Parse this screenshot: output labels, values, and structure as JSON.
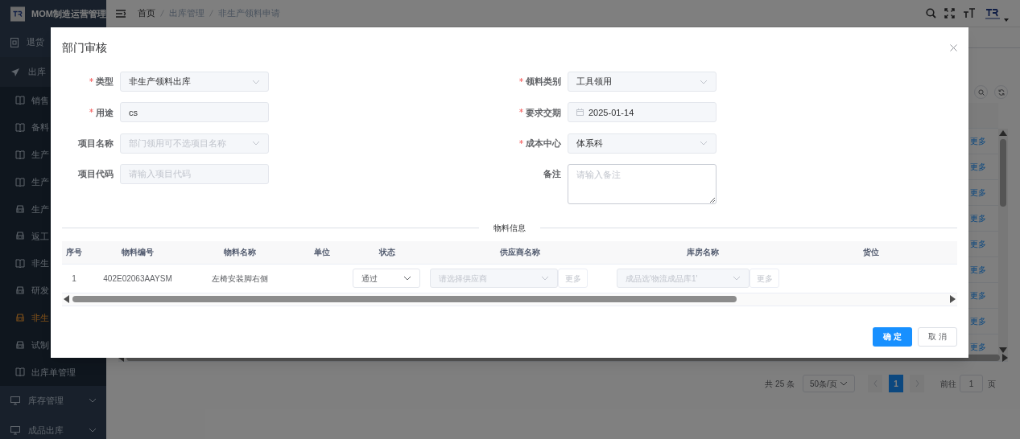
{
  "sidebar": {
    "title": "MOM制造运营管理",
    "items": [
      {
        "label": "退货"
      },
      {
        "label": "出库",
        "expanded": true,
        "children": [
          {
            "label": "销售",
            "selected": false
          },
          {
            "label": "备料",
            "selected": false
          },
          {
            "label": "生产",
            "selected": false
          },
          {
            "label": "生产",
            "selected": false
          },
          {
            "label": "生产",
            "selected": false
          },
          {
            "label": "返工",
            "selected": false
          },
          {
            "label": "非生",
            "selected": false
          },
          {
            "label": "研发",
            "selected": false
          },
          {
            "label": "非生",
            "selected": true
          },
          {
            "label": "试制",
            "selected": false
          },
          {
            "label": "出库单管理",
            "selected": false
          }
        ]
      },
      {
        "label": "库存管理",
        "expanded": false
      },
      {
        "label": "成品出库",
        "expanded": false
      }
    ]
  },
  "header": {
    "breadcrumb": [
      "首页",
      "出库管理",
      "非生产领料申请"
    ]
  },
  "list": {
    "more_links": [
      "更多",
      "更多",
      "更多",
      "更多",
      "更多",
      "更多",
      "更多",
      "更多",
      "更多"
    ]
  },
  "pagination": {
    "total": "共 25 条",
    "page_size": "50条/页",
    "pages": [
      {
        "label": "1",
        "selected": true
      }
    ],
    "goto_label": "前往",
    "goto_value": "1",
    "page_suffix": "页"
  },
  "dialog": {
    "title": "部门审核",
    "fields_left": [
      {
        "label": "类型",
        "required": true,
        "kind": "select",
        "value": "非生产领料出库",
        "disabled": true
      },
      {
        "label": "用途",
        "required": true,
        "kind": "input",
        "value": "cs",
        "disabled": true
      },
      {
        "label": "项目名称",
        "required": false,
        "kind": "select",
        "placeholder": "部门领用可不选项目名称",
        "disabled": true
      },
      {
        "label": "项目代码",
        "required": false,
        "kind": "input",
        "placeholder": "请输入项目代码",
        "disabled": true
      }
    ],
    "fields_right": [
      {
        "label": "领料类别",
        "required": true,
        "kind": "select",
        "value": "工具领用",
        "disabled": true
      },
      {
        "label": "要求交期",
        "required": true,
        "kind": "date",
        "value": "2025-01-14",
        "disabled": true
      },
      {
        "label": "成本中心",
        "required": true,
        "kind": "select",
        "value": "体系科",
        "disabled": true
      },
      {
        "label": "备注",
        "required": false,
        "kind": "textarea",
        "placeholder": "请输入备注",
        "disabled": false
      }
    ],
    "section_title": "物料信息",
    "table": {
      "columns": [
        "序号",
        "物料编号",
        "物料名称",
        "单位",
        "状态",
        "供应商名称",
        "库房名称",
        "货位"
      ],
      "rows": [
        {
          "index": "1",
          "code": "402E02063AAYSM",
          "name": "左椅安装脚右侧",
          "status": {
            "value": "通过",
            "disabled": false
          },
          "supplier": {
            "placeholder": "请选择供应商",
            "disabled": true,
            "more": "更多"
          },
          "warehouse": {
            "placeholder": "成品选'物流成品库1'",
            "disabled": true,
            "more": "更多"
          }
        }
      ]
    },
    "buttons": [
      {
        "label": "确 定",
        "kind": "primary"
      },
      {
        "label": "取 消",
        "kind": "default"
      }
    ]
  }
}
